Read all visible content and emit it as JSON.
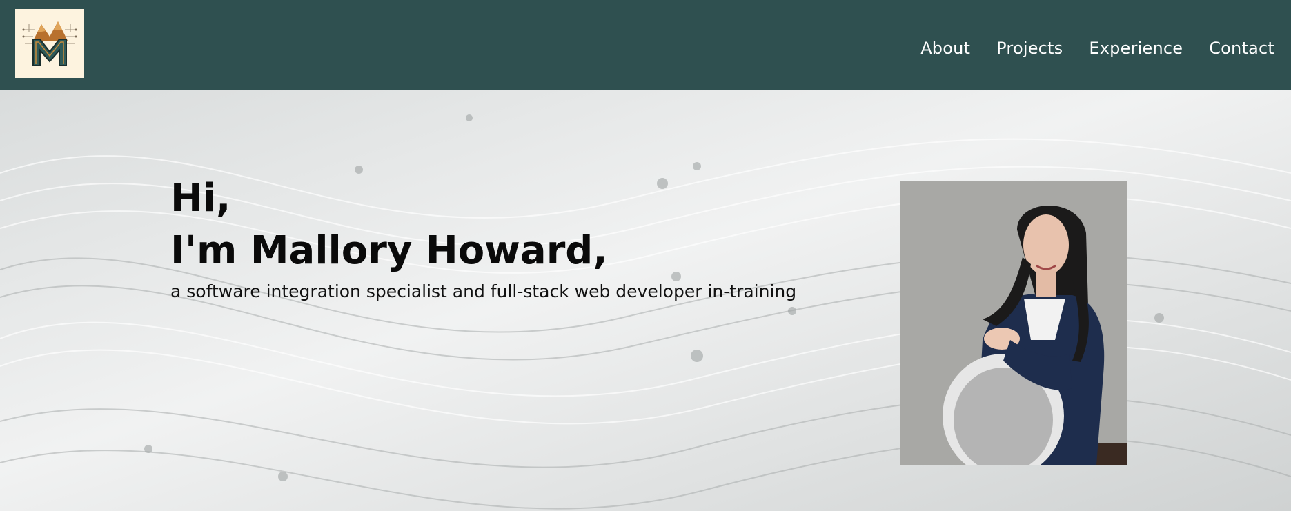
{
  "header": {
    "logo_alt": "M",
    "nav": [
      {
        "label": "About"
      },
      {
        "label": "Projects"
      },
      {
        "label": "Experience"
      },
      {
        "label": "Contact"
      }
    ]
  },
  "hero": {
    "greeting": "Hi,",
    "name": "I'm Mallory Howard,",
    "tagline": "a software integration specialist and full-stack web developer in-training"
  },
  "colors": {
    "header_bg": "#2f5050",
    "logo_bg": "#fdf3df",
    "nav_text": "#ffffff",
    "hero_text": "#0a0a0a"
  }
}
